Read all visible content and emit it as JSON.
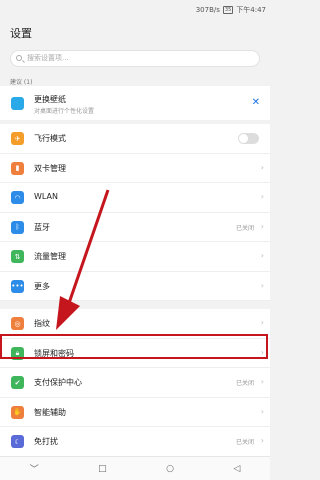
{
  "status": {
    "speed": "307B/s",
    "battery": "35",
    "time": "下午4:47"
  },
  "page": {
    "title": "设置"
  },
  "search": {
    "placeholder": "搜索设置项..."
  },
  "suggestion": {
    "header": "建议 (1)",
    "title": "更换壁纸",
    "subtitle": "对桌面进行个性化设置"
  },
  "rows": [
    {
      "label": "飞行模式",
      "color": "#f59d2a",
      "icon": "airplane-icon"
    },
    {
      "label": "双卡管理",
      "color": "#ef7f3c",
      "icon": "sim-icon"
    },
    {
      "label": "WLAN",
      "color": "#2c8ce8",
      "icon": "wifi-icon"
    },
    {
      "label": "蓝牙",
      "value": "已关闭",
      "color": "#2c8ce8",
      "icon": "bluetooth-icon"
    },
    {
      "label": "流量管理",
      "color": "#3fb65b",
      "icon": "data-icon"
    },
    {
      "label": "更多",
      "color": "#2c8ce8",
      "icon": "more-icon"
    },
    {
      "label": "指纹",
      "color": "#ef7f3c",
      "icon": "fingerprint-icon"
    },
    {
      "label": "锁屏和密码",
      "color": "#3fb65b",
      "icon": "lock-icon"
    },
    {
      "label": "支付保护中心",
      "value": "已关闭",
      "color": "#3fb65b",
      "icon": "shield-icon"
    },
    {
      "label": "智能辅助",
      "color": "#ef7f3c",
      "icon": "hand-icon"
    },
    {
      "label": "免打扰",
      "value": "已关闭",
      "color": "#5a6bd8",
      "icon": "moon-icon"
    }
  ]
}
